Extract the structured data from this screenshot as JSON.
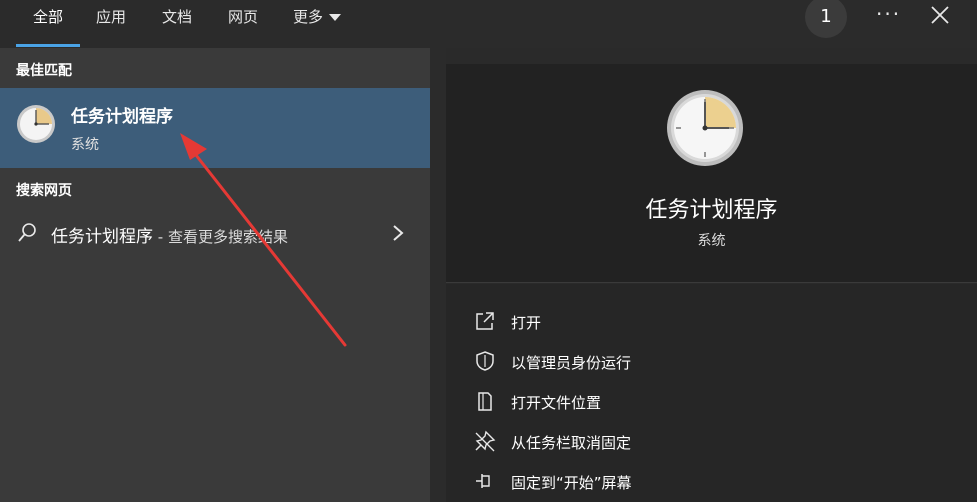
{
  "tabs": [
    {
      "label": "全部",
      "active": true
    },
    {
      "label": "应用",
      "active": false
    },
    {
      "label": "文档",
      "active": false
    },
    {
      "label": "网页",
      "active": false
    },
    {
      "label": "更多",
      "active": false
    }
  ],
  "badge_count": "1",
  "menu_dots": "···",
  "best_match": {
    "section_title": "最佳匹配",
    "title": "任务计划程序",
    "subtitle": "系统"
  },
  "web_search": {
    "section_title": "搜索网页",
    "query": "任务计划程序",
    "suffix": " - 查看更多搜索结果"
  },
  "preview": {
    "title": "任务计划程序",
    "subtitle": "系统"
  },
  "actions": [
    {
      "label": "打开",
      "icon": "open-external-icon"
    },
    {
      "label": "以管理员身份运行",
      "icon": "shield-icon"
    },
    {
      "label": "打开文件位置",
      "icon": "file-location-icon"
    },
    {
      "label": "从任务栏取消固定",
      "icon": "unpin-icon"
    },
    {
      "label": "固定到“开始”屏幕",
      "icon": "pin-icon"
    }
  ],
  "colors": {
    "accent_underline": "#4aa3e6",
    "selected_row": "#3d5d7a",
    "annotation_arrow": "#e53935"
  }
}
